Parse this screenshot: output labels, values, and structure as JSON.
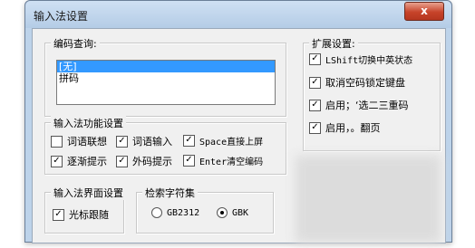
{
  "window": {
    "title": "输入法设置",
    "close_label": "x"
  },
  "code_query": {
    "label": "编码查询:",
    "items": [
      "[无]",
      "拼码"
    ],
    "selected_index": 0
  },
  "functions": {
    "label": "输入法功能设置",
    "options": [
      {
        "label": "词语联想",
        "checked": false
      },
      {
        "label": "词语输入",
        "checked": true
      },
      {
        "label": "Space直接上屏",
        "checked": true
      },
      {
        "label": "逐渐提示",
        "checked": true
      },
      {
        "label": "外码提示",
        "checked": true
      },
      {
        "label": "Enter清空编码",
        "checked": true
      }
    ]
  },
  "extended": {
    "label": "扩展设置:",
    "options": [
      {
        "label": "LShift切换中英状态",
        "checked": true
      },
      {
        "label": "取消空码锁定键盘",
        "checked": true
      },
      {
        "label": "启用；‘选二三重码",
        "checked": true
      },
      {
        "label": "启用，。翻页",
        "checked": true
      }
    ]
  },
  "interface": {
    "label": "输入法界面设置",
    "options": [
      {
        "label": "光标跟随",
        "checked": true
      }
    ]
  },
  "charset": {
    "label": "检索字符集",
    "options": [
      {
        "label": "GB2312",
        "selected": false
      },
      {
        "label": "GBK",
        "selected": true
      }
    ]
  }
}
